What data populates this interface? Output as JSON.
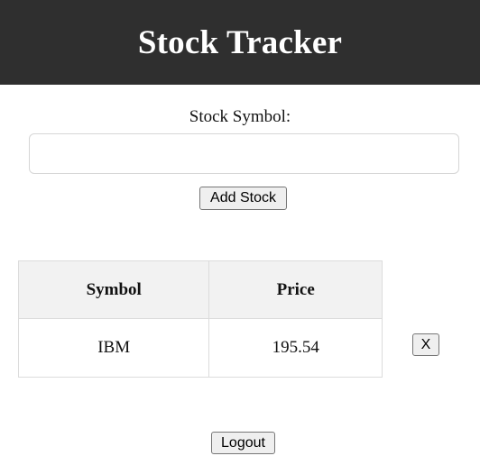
{
  "header": {
    "title": "Stock Tracker"
  },
  "form": {
    "symbol_label": "Stock Symbol:",
    "symbol_value": "",
    "symbol_placeholder": "",
    "add_label": "Add Stock"
  },
  "table": {
    "columns": [
      "Symbol",
      "Price"
    ],
    "rows": [
      {
        "symbol": "IBM",
        "price": "195.54",
        "remove_label": "X"
      }
    ]
  },
  "footer": {
    "logout_label": "Logout"
  },
  "colors": {
    "header_bg": "#2f2f2f",
    "header_text": "#ffffff",
    "table_header_bg": "#f2f2f2",
    "button_bg": "#efefef"
  }
}
